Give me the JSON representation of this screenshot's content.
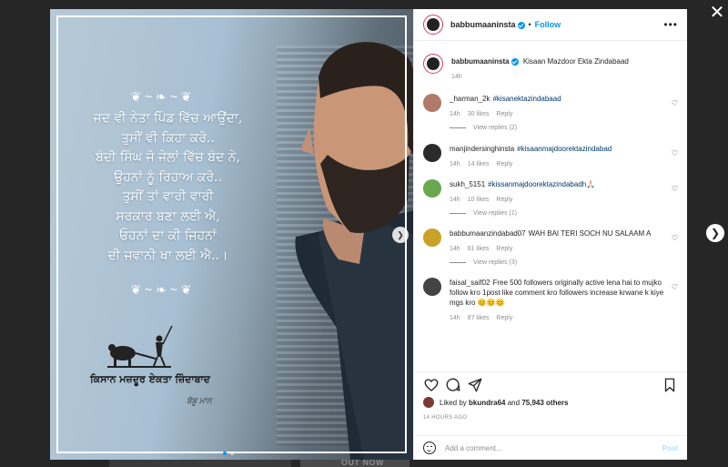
{
  "background": {
    "banner_text": "OUT NOW"
  },
  "post": {
    "author": "babbumaaninsta",
    "follow_label": "Follow",
    "more_label": "•••",
    "caption": "Kisaan Mazdoor Ekta Zindabaad",
    "caption_time": "14h",
    "image": {
      "lines": [
        "ਜਦ ਵੀ ਨੇਤਾ ਪਿੰਡ ਵਿੱਚ ਆਉਂਦਾ,",
        "ਤੁਸੀਂ ਵੀ ਕਿਹਾ ਕਰੋ..",
        "ਬੰਦੀ ਸਿੰਘ ਜੋ ਜੇਲਾਂ ਵਿੱਚ ਬੰਦ ਨੇ,",
        "ਉਹਨਾਂ ਨੂੰ ਰਿਹਾਅ ਕਰੋ..",
        "ਤੁਸੀਂ ਤਾਂ ਵਾਰੀ ਵਾਰੀ",
        "ਸਰਕਾਰ ਬਣਾ ਲਈ ਐ,",
        "ਓਹਨਾਂ ਦਾ ਕੀ ਜਿਹਨਾਂ",
        "ਦੀ ਜਵਾਨੀ ਖਾ ਲਈ ਐ..।"
      ],
      "footer_caption": "ਕਿਸਾਨ ਮਜ਼ਦੂਰ ਏਕਤਾ ਜ਼ਿੰਦਾਬਾਦ",
      "signature": "ਬੱਬੂ ਮਾਨ"
    }
  },
  "comments": [
    {
      "user": "_harman_2k",
      "text": "#kisanektazindabaad",
      "time": "14h",
      "likes": "30 likes",
      "reply": "Reply",
      "view_replies": "View replies (2)",
      "avatar_color": "#b07a6a"
    },
    {
      "user": "manjindersinghinsta",
      "text": "#kisaanmajdoorektazindabad",
      "time": "14h",
      "likes": "14 likes",
      "reply": "Reply",
      "view_replies": "",
      "avatar_color": "#2b2b2b"
    },
    {
      "user": "sukh_5151",
      "text": "#kissanmajdoorektazindabadh🙏🏻",
      "time": "14h",
      "likes": "10 likes",
      "reply": "Reply",
      "view_replies": "View replies (1)",
      "avatar_color": "#6aa84f"
    },
    {
      "user": "babbumaanzindabad07",
      "text": "WAH BAI TERI SOCH NU SALAAM A",
      "time": "14h",
      "likes": "81 likes",
      "reply": "Reply",
      "view_replies": "View replies (3)",
      "avatar_color": "#c9a227"
    },
    {
      "user": "faisal_saif02",
      "text": "Free 500 followers originally active lena hai to mujko follow kro 1post like comment kro followers increase krwane k kiye mgs kro 😊😊😊",
      "time": "14h",
      "likes": "87 likes",
      "reply": "Reply",
      "view_replies": "",
      "avatar_color": "#444444"
    }
  ],
  "liked_by": {
    "prefix": "Liked by",
    "user": "bkundra64",
    "and": "and",
    "count": "75,943 others"
  },
  "posted_ago": "14 HOURS AGO",
  "add_comment": {
    "placeholder": "Add a comment...",
    "post_label": "Post"
  },
  "icons": [
    "heart-icon",
    "comment-icon",
    "share-icon",
    "bookmark-icon",
    "emoji-icon",
    "close-icon",
    "chevron-right-icon"
  ],
  "colors": {
    "accent": "#0095f6",
    "hashtag": "#00376b",
    "muted": "#8e8e8e",
    "post_disabled": "#b2dffc"
  }
}
